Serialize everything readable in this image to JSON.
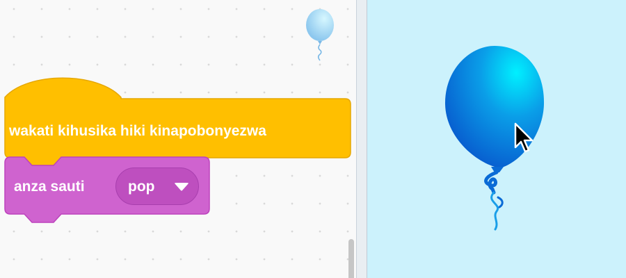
{
  "code_area": {
    "hat_block": {
      "label": "wakati kihusika hiki kinapobonyezwa",
      "color": "#FFBF00",
      "border_color": "#E6A700"
    },
    "sound_block": {
      "label": "anza sauti",
      "sound_name": "pop",
      "color": "#CF63CF",
      "border_color": "#BD42BD",
      "dropdown_icon": "chevron-down-icon"
    },
    "sprite_thumbnail_icon": "balloon-icon"
  },
  "stage": {
    "background_color": "#CCF2FC",
    "sprite_icon": "balloon-icon",
    "sprite_color": "#0F8FE6",
    "cursor_icon": "mouse-pointer-icon"
  }
}
